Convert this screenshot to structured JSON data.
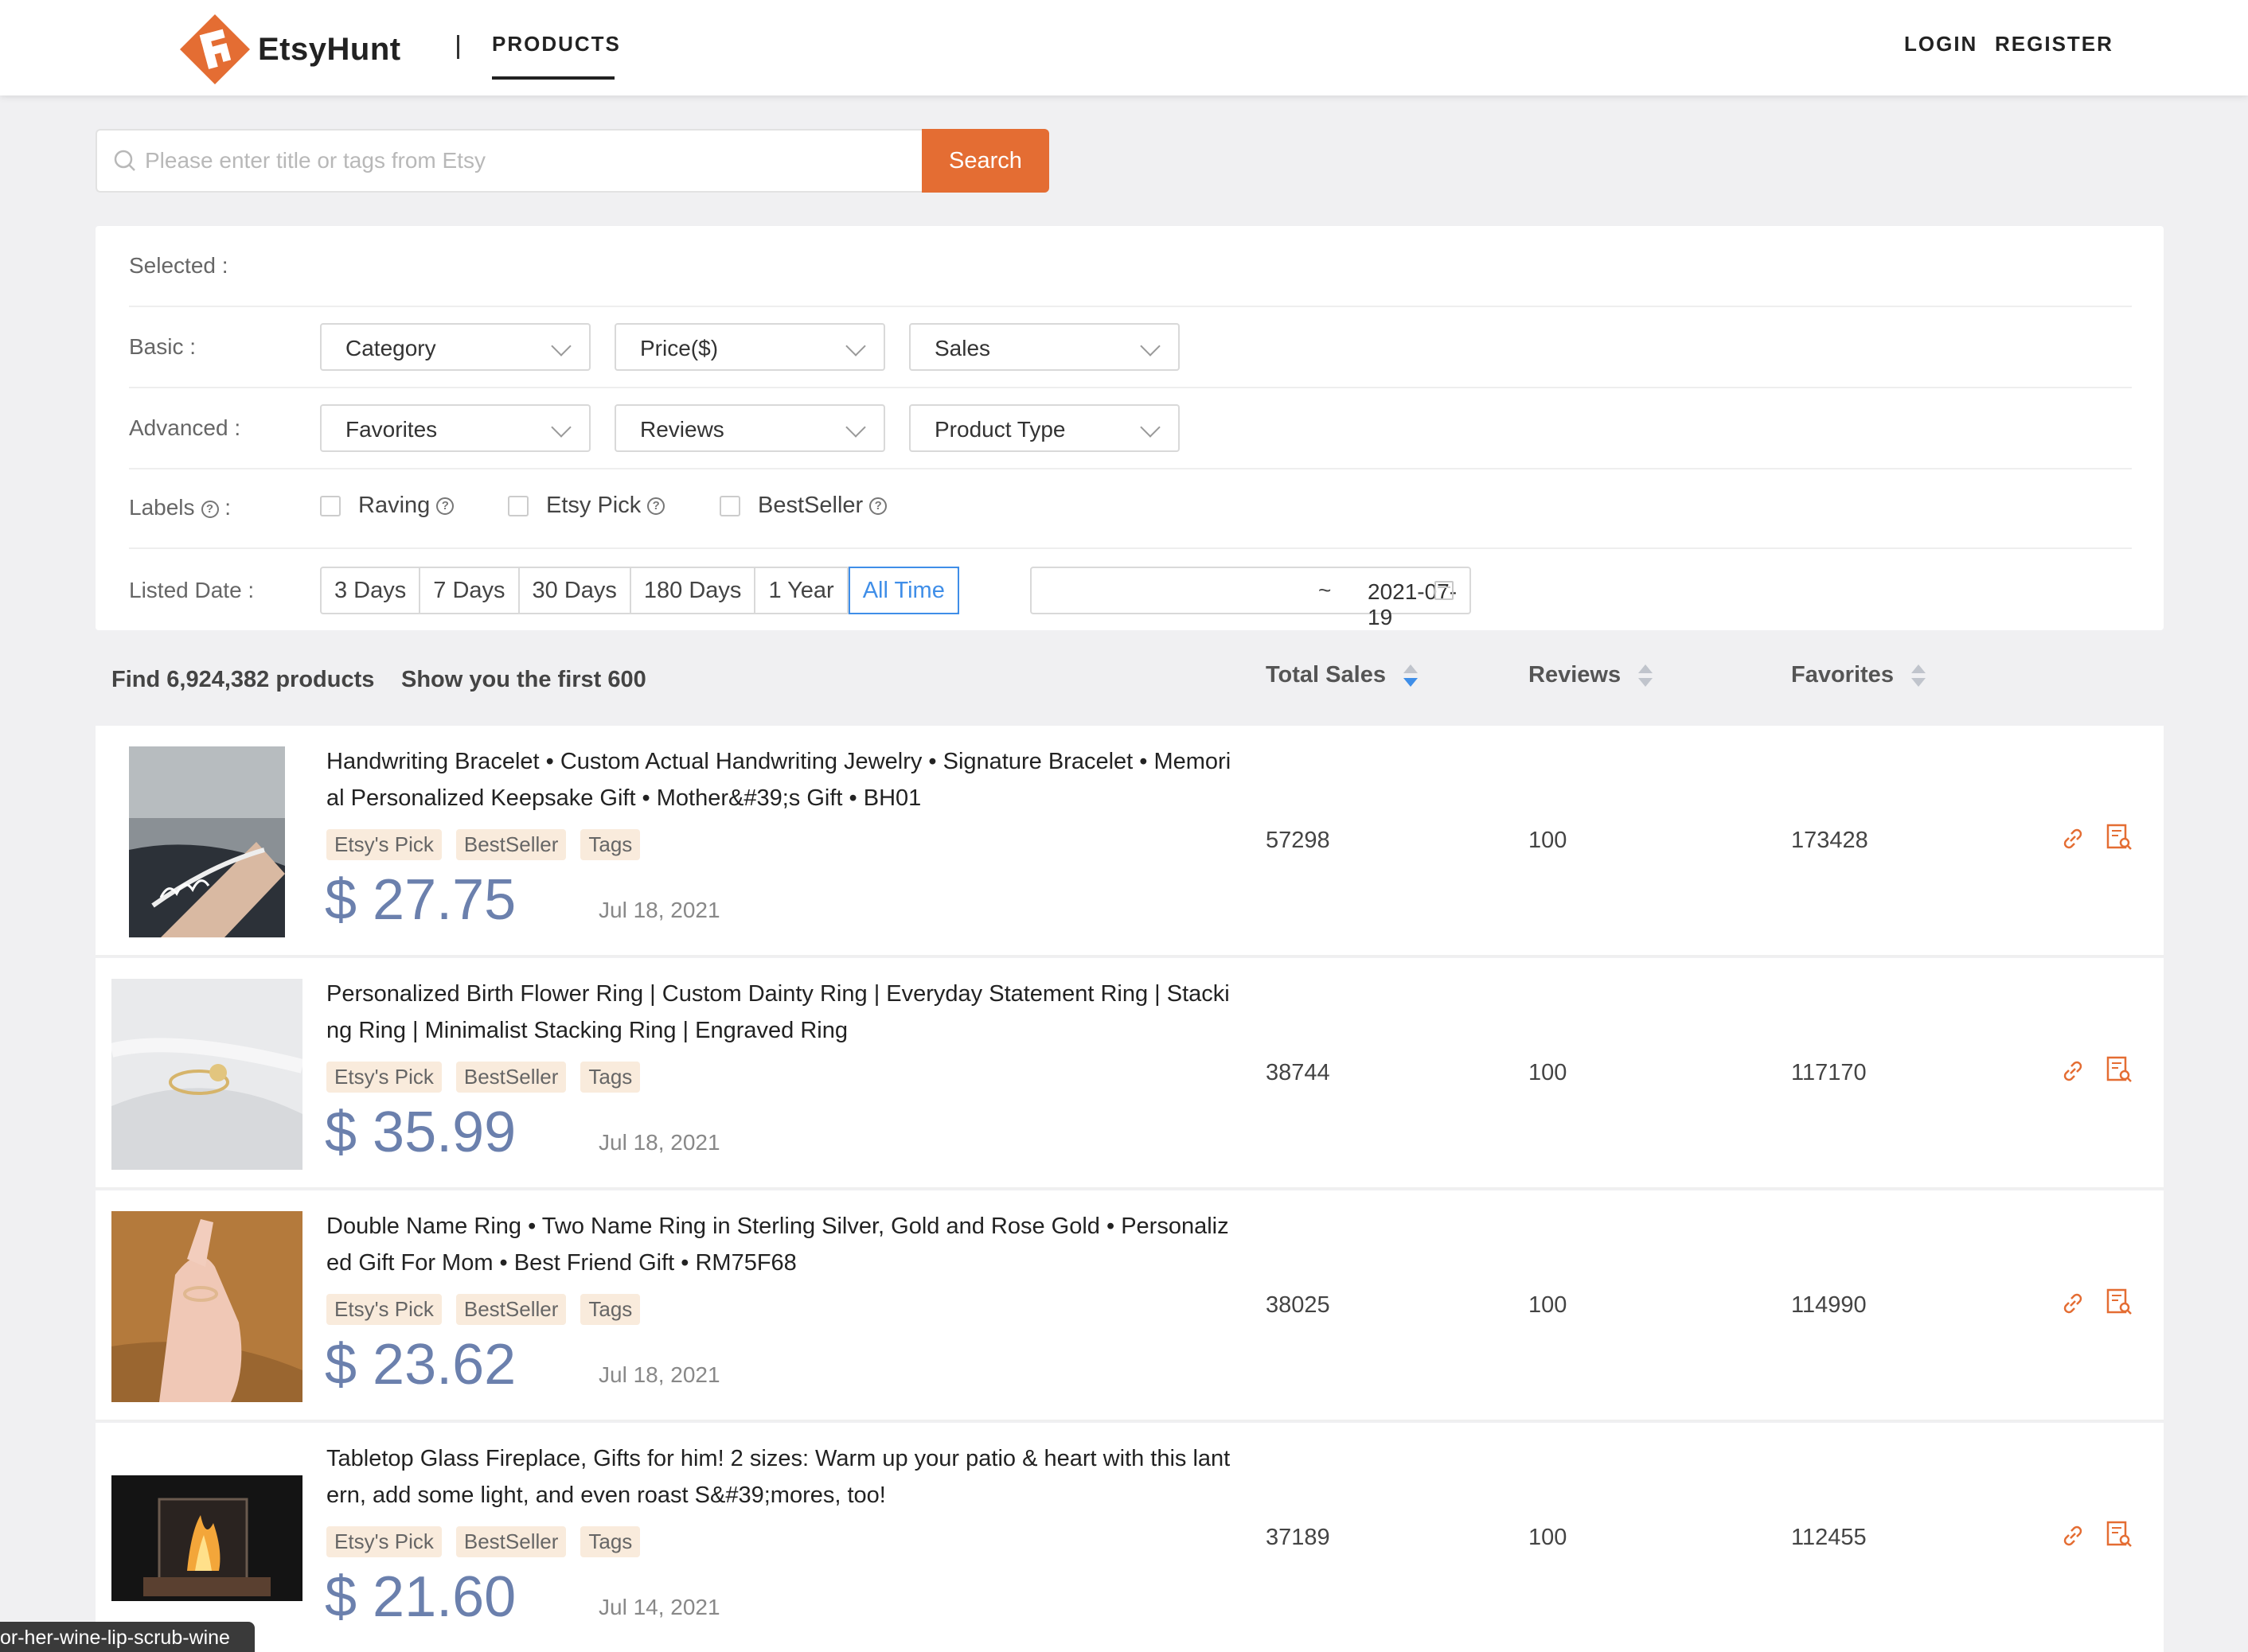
{
  "header": {
    "logo_text": "EtsyHunt",
    "nav_products": "PRODUCTS",
    "login": "LOGIN",
    "register": "REGISTER",
    "accent_color": "#e46d33"
  },
  "search": {
    "placeholder": "Please enter title or tags from Etsy",
    "value": "",
    "button_label": "Search"
  },
  "filters": {
    "selected_label": "Selected :",
    "basic_label": "Basic :",
    "basic_selects": [
      "Category",
      "Price($)",
      "Sales"
    ],
    "advanced_label": "Advanced :",
    "advanced_selects": [
      "Favorites",
      "Reviews",
      "Product Type"
    ],
    "labels_label": "Labels",
    "labels_colon": ":",
    "checkboxes": [
      "Raving",
      "Etsy Pick",
      "BestSeller"
    ],
    "listed_date_label": "Listed Date :",
    "date_options": [
      "3 Days",
      "7 Days",
      "30 Days",
      "180 Days",
      "1 Year",
      "All Time"
    ],
    "date_active": "All Time",
    "date_range_start": "",
    "date_range_sep": "~",
    "date_range_end": "2021-07-19"
  },
  "results": {
    "find_text": "Find 6,924,382 products",
    "show_text": "Show you the first 600",
    "columns": [
      "Total Sales",
      "Reviews",
      "Favorites"
    ]
  },
  "products": [
    {
      "title": "Handwriting Bracelet • Custom Actual Handwriting Jewelry • Signature Bracelet • Memorial Personalized Keepsake Gift • Mother&#39;s Gift • BH01",
      "tags": [
        "Etsy's Pick",
        "BestSeller",
        "Tags"
      ],
      "price": "$ 27.75",
      "date": "Jul 18, 2021",
      "total_sales": "57298",
      "reviews": "100",
      "favorites": "173428"
    },
    {
      "title": "Personalized Birth Flower Ring | Custom Dainty Ring | Everyday Statement Ring | Stacking Ring | Minimalist Stacking Ring | Engraved Ring",
      "tags": [
        "Etsy's Pick",
        "BestSeller",
        "Tags"
      ],
      "price": "$ 35.99",
      "date": "Jul 18, 2021",
      "total_sales": "38744",
      "reviews": "100",
      "favorites": "117170"
    },
    {
      "title": "Double Name Ring • Two Name Ring in Sterling Silver, Gold and Rose Gold • Personalized Gift For Mom • Best Friend Gift • RM75F68",
      "tags": [
        "Etsy's Pick",
        "BestSeller",
        "Tags"
      ],
      "price": "$ 23.62",
      "date": "Jul 18, 2021",
      "total_sales": "38025",
      "reviews": "100",
      "favorites": "114990"
    },
    {
      "title": "Tabletop Glass Fireplace, Gifts for him! 2 sizes: Warm up your patio & heart with this lantern, add some light, and even roast S&#39;mores, too!",
      "tags": [
        "Etsy's Pick",
        "BestSeller",
        "Tags"
      ],
      "price": "$ 21.60",
      "date": "Jul 14, 2021",
      "total_sales": "37189",
      "reviews": "100",
      "favorites": "112455"
    }
  ],
  "status_bar": {
    "url_text": "or-her-wine-lip-scrub-wine"
  }
}
